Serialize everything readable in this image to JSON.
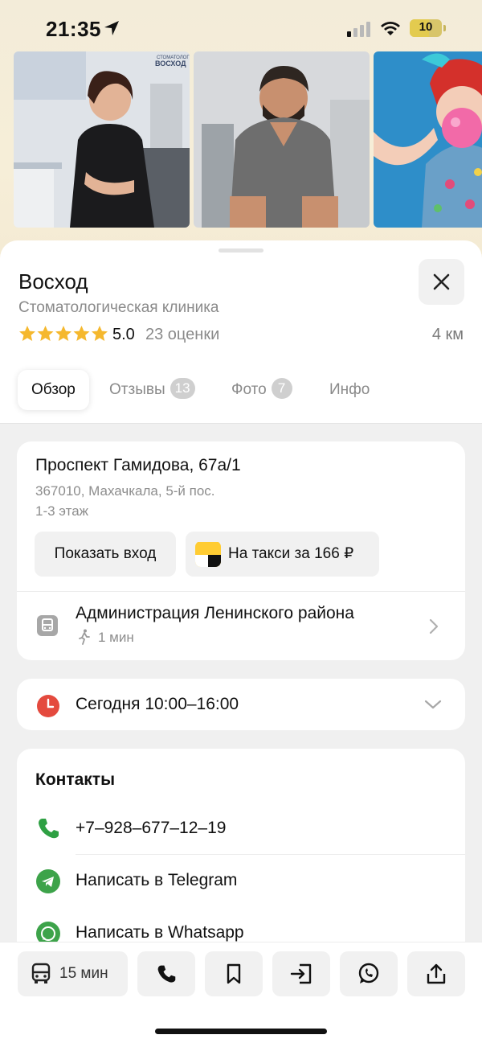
{
  "status_bar": {
    "time": "21:35",
    "battery": "10"
  },
  "photos": [
    {
      "name": "photo-doctor-woman",
      "watermark": "СТОМАТОЛОГИЯ\nВОСХОД"
    },
    {
      "name": "photo-doctor-man"
    },
    {
      "name": "photo-woman-bubblegum"
    }
  ],
  "place": {
    "title": "Восход",
    "category": "Стоматологическая клиника",
    "rating": "5.0",
    "rating_count": "23 оценки",
    "distance": "4 км",
    "stars": 5
  },
  "tabs": [
    {
      "label": "Обзор",
      "active": true
    },
    {
      "label": "Отзывы",
      "badge": "13"
    },
    {
      "label": "Фото",
      "badge": "7"
    },
    {
      "label": "Инфо"
    }
  ],
  "address": {
    "street": "Проспект Гамидова, 67а/1",
    "city": "367010, Махачкала, 5-й пос.",
    "floor": "1-3 этаж",
    "show_entrance": "Показать вход",
    "taxi": "На такси за 166 ₽",
    "stop_name": "Администрация Ленинского района",
    "stop_walk": "1 мин"
  },
  "hours": {
    "text": "Сегодня 10:00–16:00"
  },
  "contacts": {
    "title": "Контакты",
    "phone": "+7‒928‒677‒12‒19",
    "telegram": "Написать в Telegram",
    "whatsapp": "Написать в Whatsapp"
  },
  "bottom_bar": {
    "transit_time": "15 мин"
  },
  "colors": {
    "star": "#f5b82e",
    "hours_icon": "#e44a3e",
    "phone": "#2ea043",
    "telegram": "#3da34a",
    "whatsapp": "#3da34a"
  }
}
